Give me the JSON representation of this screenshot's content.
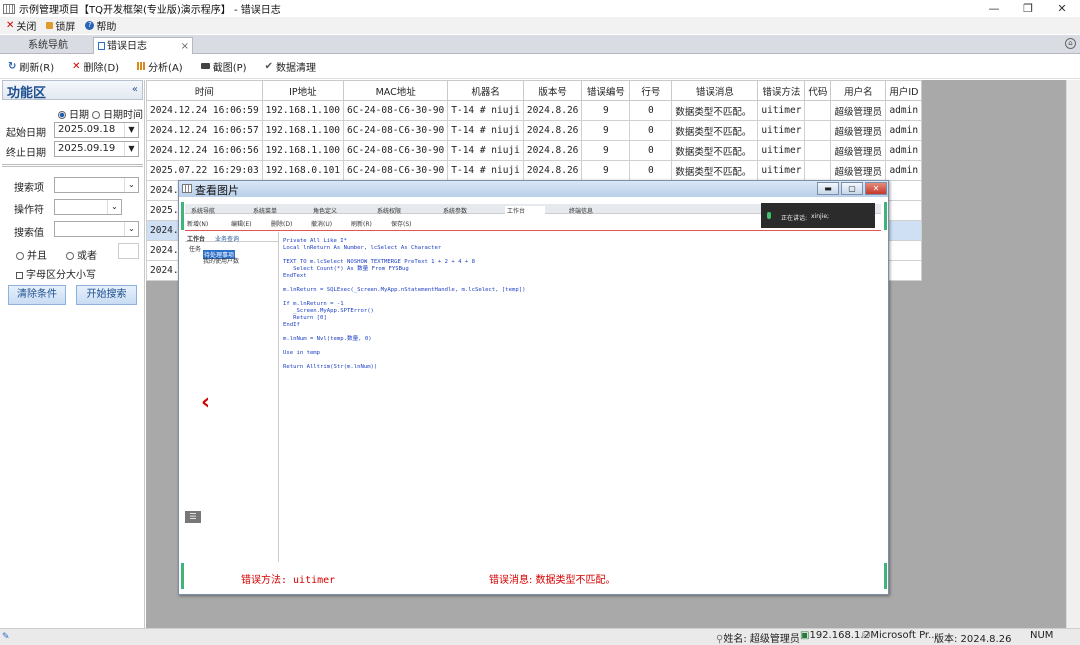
{
  "window": {
    "title": "示例管理项目【TQ开发框架(专业版)演示程序】 - 错误日志",
    "minimize": "—",
    "restore": "❐",
    "close": "✕"
  },
  "menu": {
    "close": "关闭",
    "lock": "锁屏",
    "help": "帮助"
  },
  "tabs": [
    {
      "label": "系统导航"
    },
    {
      "label": "错误日志",
      "close": "×"
    }
  ],
  "toolbar": {
    "refresh": "刷新(R)",
    "delete": "删除(D)",
    "analyze": "分析(A)",
    "screenshot": "截图(P)",
    "clear": "数据清理"
  },
  "left_panel": {
    "title": "功能区",
    "collapse": "«",
    "radio_date": "日期",
    "radio_datetime": "日期时间",
    "start_label": "起始日期",
    "start_value": "2025.09.18",
    "end_label": "终止日期",
    "end_value": "2025.09.19",
    "search_item_label": "搜索项",
    "operator_label": "操作符",
    "search_value_label": "搜索值",
    "and": "并且",
    "or": "或者",
    "case_sensitive": "字母区分大小写",
    "clear_btn": "清除条件",
    "search_btn": "开始搜索"
  },
  "table": {
    "columns": [
      "时间",
      "IP地址",
      "MAC地址",
      "机器名",
      "版本号",
      "错误编号",
      "行号",
      "错误消息",
      "错误方法",
      "代码",
      "用户名",
      "用户ID"
    ],
    "rows": [
      [
        "2024.12.24 16:06:59",
        "192.168.1.100",
        "6C-24-08-C6-30-90",
        "T-14 # niuji",
        "2024.8.26",
        "9",
        "0",
        "数据类型不匹配。",
        "uitimer",
        "",
        "超级管理员",
        "admin"
      ],
      [
        "2024.12.24 16:06:57",
        "192.168.1.100",
        "6C-24-08-C6-30-90",
        "T-14 # niuji",
        "2024.8.26",
        "9",
        "0",
        "数据类型不匹配。",
        "uitimer",
        "",
        "超级管理员",
        "admin"
      ],
      [
        "2024.12.24 16:06:56",
        "192.168.1.100",
        "6C-24-08-C6-30-90",
        "T-14 # niuji",
        "2024.8.26",
        "9",
        "0",
        "数据类型不匹配。",
        "uitimer",
        "",
        "超级管理员",
        "admin"
      ],
      [
        "2025.07.22 16:29:03",
        "192.168.0.101",
        "6C-24-08-C6-30-90",
        "T-14 # niuji",
        "2024.8.26",
        "9",
        "0",
        "数据类型不匹配。",
        "uitimer",
        "",
        "超级管理员",
        "admin"
      ],
      [
        "2024.1",
        "",
        "",
        "",
        "",
        "",
        "",
        "",
        "",
        "",
        "",
        ""
      ],
      [
        "2025.0",
        "",
        "",
        "",
        "",
        "",
        "",
        "",
        "",
        "",
        "",
        ""
      ],
      [
        "2024.1",
        "",
        "",
        "",
        "",
        "",
        "",
        "",
        "",
        "",
        "",
        ""
      ],
      [
        "2024.1",
        "",
        "",
        "",
        "",
        "",
        "",
        "",
        "",
        "",
        "",
        ""
      ],
      [
        "2024.1",
        "",
        "",
        "",
        "",
        "",
        "",
        "",
        "",
        "",
        "",
        ""
      ]
    ]
  },
  "popup": {
    "title": "查看图片",
    "inner_tabs": [
      "系统导航",
      "系统菜单",
      "角色定义",
      "系统权限",
      "系统参数",
      "工作台",
      "终端信息"
    ],
    "inner_toolbar": [
      "新增(N)",
      "编辑(E)",
      "删除(D)",
      "撤消(U)",
      "刷新(R)",
      "保存(S)"
    ],
    "left_tabs": [
      "工作台",
      "业务查询"
    ],
    "tree": [
      "任务",
      "待处理事项",
      "我的使用户数"
    ],
    "speaking_label": "正在讲话:",
    "speaking_user": "xinjie;",
    "code_lines": [
      "Private All Like I*",
      "Local lnReturn As Number, lcSelect As Character",
      "",
      "TEXT TO m.lcSelect NOSHOW TEXTMERGE PreText 1 + 2 + 4 + 8",
      "   Select Count(*) As 数量 From FYSBug",
      "EndText",
      "",
      "m.lnReturn = SQLExec(_Screen.MyApp.nStatementHandle, m.lcSelect, [temp])",
      "",
      "If m.lnReturn = -1",
      "   _Screen.MyApp.SPTError()",
      "   Return [0]",
      "EndIf",
      "",
      "m.lnNum = Nvl(temp.数量, 0)",
      "",
      "Use in temp",
      "",
      "Return Alltrim(Str(m.lnNum))"
    ],
    "footer_method": "错误方法: uitimer",
    "footer_message": "错误消息: 数据类型不匹配。"
  },
  "statusbar": {
    "user": "姓名: 超级管理员",
    "ip": "192.168.1.2",
    "db": "Microsoft Pr...",
    "version": "版本: 2024.8.26",
    "num": "NUM"
  },
  "colors": {
    "accent": "#1f4f8f",
    "error_red": "#d40000"
  }
}
